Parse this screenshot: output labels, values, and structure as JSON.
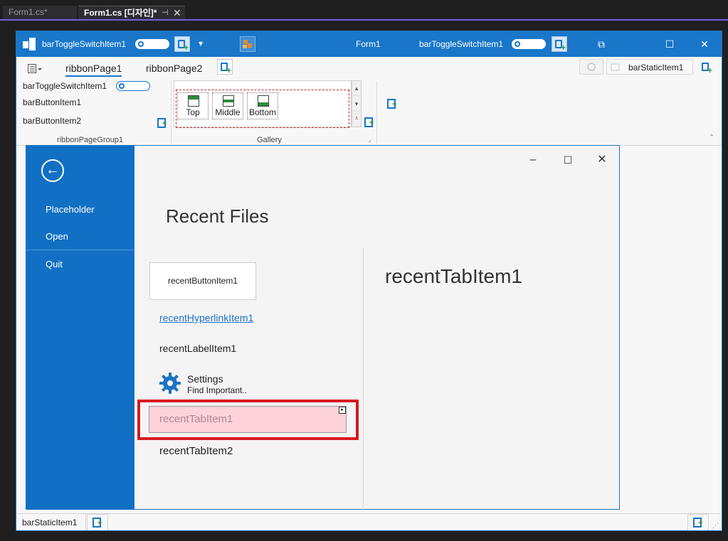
{
  "vs": {
    "tabs": [
      {
        "label": "Form1.cs*"
      },
      {
        "label": "Form1.cs [디자인]*"
      }
    ],
    "pin_glyph": "⊣",
    "close_glyph": "✕"
  },
  "form": {
    "title": "Form1",
    "toolbar": {
      "toggle_left_label": "barToggleSwitchItem1",
      "toggle_right_label": "barToggleSwitchItem1"
    },
    "window_controls": {
      "restore": "⧉",
      "maximize": "☐",
      "close": "✕"
    }
  },
  "ribbon": {
    "tabs": [
      {
        "label": "ribbonPage1",
        "selected": true
      },
      {
        "label": "ribbonPage2",
        "selected": false
      }
    ],
    "right_static": "barStaticItem1",
    "group1": {
      "items": [
        "barToggleSwitchItem1",
        "barButtonItem1",
        "barButtonItem2"
      ],
      "caption": "ribbonPageGroup1"
    },
    "gallery": {
      "caption": "Gallery",
      "items": [
        {
          "label": "Top",
          "icon": "align-top-icon"
        },
        {
          "label": "Middle",
          "icon": "align-middle-icon"
        },
        {
          "label": "Bottom",
          "icon": "align-bottom-icon"
        }
      ]
    }
  },
  "backstage": {
    "nav": {
      "back_glyph": "←",
      "items": [
        "Placeholder",
        "Open",
        "Quit"
      ]
    },
    "title": "Recent Files",
    "recent_button": "recentButtonItem1",
    "recent_hyperlink": "recentHyperlinkItem1",
    "recent_label": "recentLabelItem1",
    "settings": {
      "title": "Settings",
      "description": "Find Important.."
    },
    "tab_items": [
      "recentTabItem1",
      "recentTabItem2"
    ],
    "content_title": "recentTabItem1"
  },
  "statusbar": {
    "static_label": "barStaticItem1"
  },
  "colors": {
    "accent": "#1976c9",
    "nav_bg": "#1170c4",
    "selection_frame": "#d71920",
    "selected_item_bg": "#fdd3d9",
    "vs_accent": "#7160e8"
  }
}
